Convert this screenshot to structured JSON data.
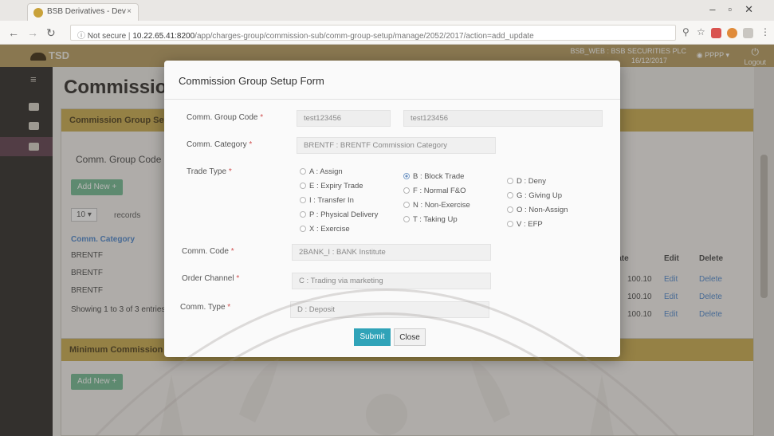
{
  "browser": {
    "tab_title": "BSB Derivatives - Dev",
    "tab_close": "×",
    "security": "Not secure",
    "host": "10.22.65.41:8200",
    "path": "/app/charges-group/commission-sub/comm-group-setup/manage/2052/2017/action=add_update"
  },
  "app": {
    "brand": "TSD",
    "company": "BSB_WEB : BSB SECURITIES PLC",
    "date_label": "16/12/2017",
    "user": "PPPP",
    "logout": "Logout"
  },
  "page": {
    "title": "Commission G",
    "panel1_header": "Commission Group Setup",
    "filter_label": "Comm. Group Code",
    "add_new": "Add New",
    "page_size": "10",
    "records_label": "records",
    "col_category": "Comm. Category",
    "col_rate": "Rate",
    "col_edit": "Edit",
    "col_delete": "Delete",
    "rows": [
      {
        "category": "BRENTF",
        "rate": "100.10",
        "edit": "Edit",
        "delete": "Delete"
      },
      {
        "category": "BRENTF",
        "rate": "100.10",
        "edit": "Edit",
        "delete": "Delete"
      },
      {
        "category": "BRENTF",
        "rate": "100.10",
        "edit": "Edit",
        "delete": "Delete"
      }
    ],
    "showing": "Showing 1 to 3 of 3 entries",
    "panel2_header": "Minimum Commission",
    "add_new2": "Add New"
  },
  "modal": {
    "title": "Commission Group Setup Form",
    "comm_group_code_label": "Comm. Group Code",
    "comm_group_code_value": "test123456",
    "comm_group_name_value": "test123456",
    "comm_category_label": "Comm. Category",
    "comm_category_value": "BRENTF : BRENTF Commission Category",
    "trade_type_label": "Trade Type",
    "trade_types": [
      {
        "label": "A : Assign",
        "checked": false
      },
      {
        "label": "E : Expiry Trade",
        "checked": false
      },
      {
        "label": "I : Transfer In",
        "checked": false
      },
      {
        "label": "P : Physical Delivery",
        "checked": false
      },
      {
        "label": "X : Exercise",
        "checked": false
      },
      {
        "label": "B : Block Trade",
        "checked": true
      },
      {
        "label": "F : Normal F&O",
        "checked": false
      },
      {
        "label": "N : Non-Exercise",
        "checked": false
      },
      {
        "label": "T : Taking Up",
        "checked": false
      },
      {
        "label": "D : Deny",
        "checked": false
      },
      {
        "label": "G : Giving Up",
        "checked": false
      },
      {
        "label": "O : Non-Assign",
        "checked": false
      },
      {
        "label": "V : EFP",
        "checked": false
      }
    ],
    "comm_code_label": "Comm. Code",
    "comm_code_value": "2BANK_I : BANK Institute",
    "order_channel_label": "Order Channel",
    "order_channel_value": "C : Trading via marketing",
    "comm_type_label": "Comm. Type",
    "comm_type_value": "D : Deposit",
    "required_mark": "*",
    "submit": "Submit",
    "close": "Close"
  }
}
